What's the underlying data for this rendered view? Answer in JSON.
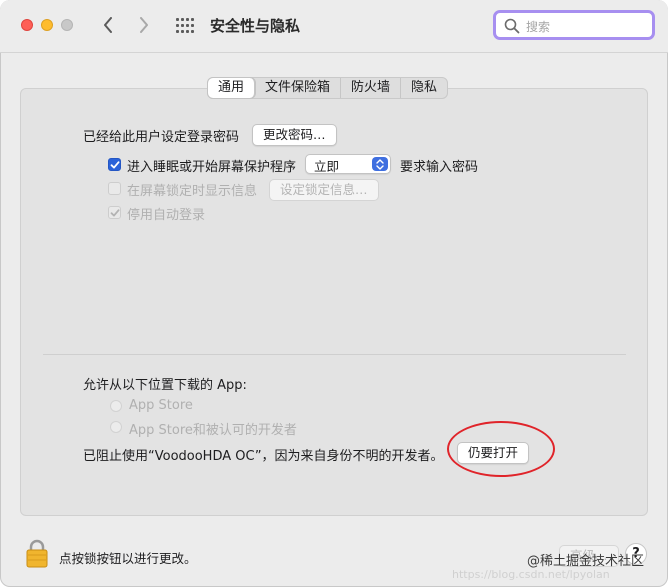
{
  "window": {
    "title": "安全性与隐私",
    "search_placeholder": "搜索"
  },
  "tabs": [
    {
      "label": "通用",
      "active": true
    },
    {
      "label": "文件保险箱",
      "active": false
    },
    {
      "label": "防火墙",
      "active": false
    },
    {
      "label": "隐私",
      "active": false
    }
  ],
  "general": {
    "password_label": "已经给此用户设定登录密码",
    "change_password_button": "更改密码…",
    "sleep_checkbox_label": "进入睡眠或开始屏幕保护程序",
    "sleep_checked": true,
    "sleep_delay_value": "立即",
    "require_password_label": "要求输入密码",
    "show_message_label": "在屏幕锁定时显示信息",
    "show_message_checked": false,
    "set_lock_message_button": "设定锁定信息…",
    "disable_autologin_label": "停用自动登录",
    "disable_autologin_checked": true
  },
  "downloads": {
    "heading": "允许从以下位置下载的 App:",
    "option_app_store": "App Store",
    "option_identified": "App Store和被认可的开发者",
    "blocked_message": "已阻止使用“VoodooHDA OC”，因为来自身份不明的开发者。",
    "open_anyway_button": "仍要打开"
  },
  "footer": {
    "lock_label": "点按锁按钮以进行更改。",
    "advanced_button": "高级…",
    "help_button": "?"
  },
  "watermark": {
    "line1": "@稀土掘金技术社区",
    "line2": "https://blog.csdn.net/lpyolan"
  },
  "colors": {
    "accent": "#2b63d9",
    "search_focus": "#a78ff0",
    "annotation_circle": "#e0242a"
  },
  "icons": [
    "back-arrow-icon",
    "forward-arrow-icon",
    "grid-icon",
    "search-icon",
    "checkmark-icon",
    "chevron-updown-icon",
    "lock-icon"
  ]
}
